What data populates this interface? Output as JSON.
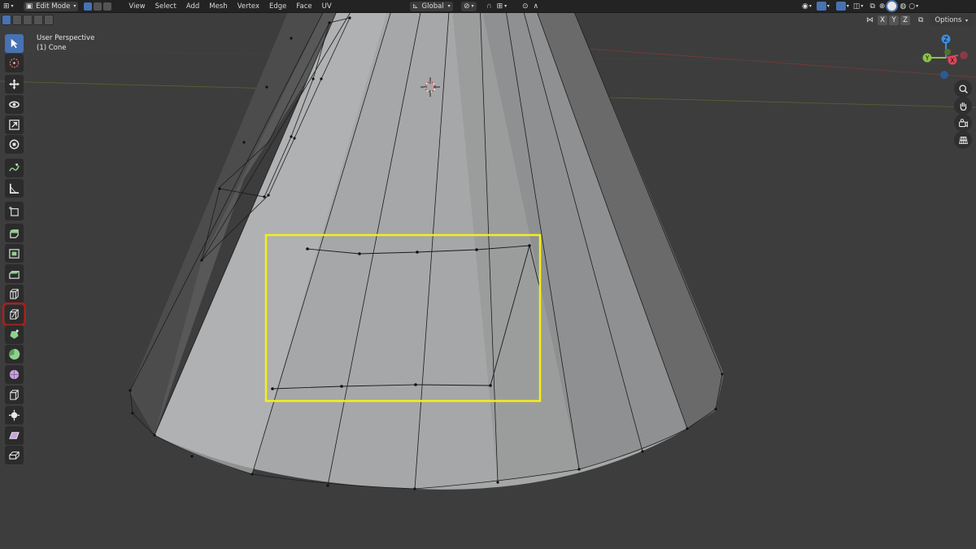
{
  "header": {
    "mode_label": "Edit Mode",
    "menus": [
      "View",
      "Select",
      "Add",
      "Mesh",
      "Vertex",
      "Edge",
      "Face",
      "UV"
    ],
    "transform_orientation": "Global",
    "options_label": "Options"
  },
  "axis_buttons": [
    "X",
    "Y",
    "Z"
  ],
  "viewport": {
    "perspective_label": "User Perspective",
    "object_label": "(1) Cone"
  },
  "gizmo": {
    "x_label": "X",
    "y_label": "Y",
    "z_label": "Z",
    "colors": {
      "x": "#e0455a",
      "y": "#8bc34a",
      "z": "#3b8ee0"
    }
  },
  "toolbar": {
    "tools": [
      "select-box-tool",
      "cursor-tool",
      "move-tool",
      "rotate-tool",
      "scale-tool",
      "transform-tool",
      "annotate-tool",
      "measure-tool",
      "add-cube-tool",
      "extrude-region-tool",
      "inset-faces-tool",
      "bevel-tool",
      "loop-cut-tool",
      "knife-tool",
      "poly-build-tool",
      "spin-tool",
      "smooth-tool",
      "edge-slide-tool",
      "shrink-fatten-tool",
      "shear-tool",
      "rip-region-tool"
    ],
    "active_tool": "select-box-tool",
    "highlighted_tool": "knife-tool"
  },
  "highlight": {
    "color": "#f5ee1a"
  }
}
